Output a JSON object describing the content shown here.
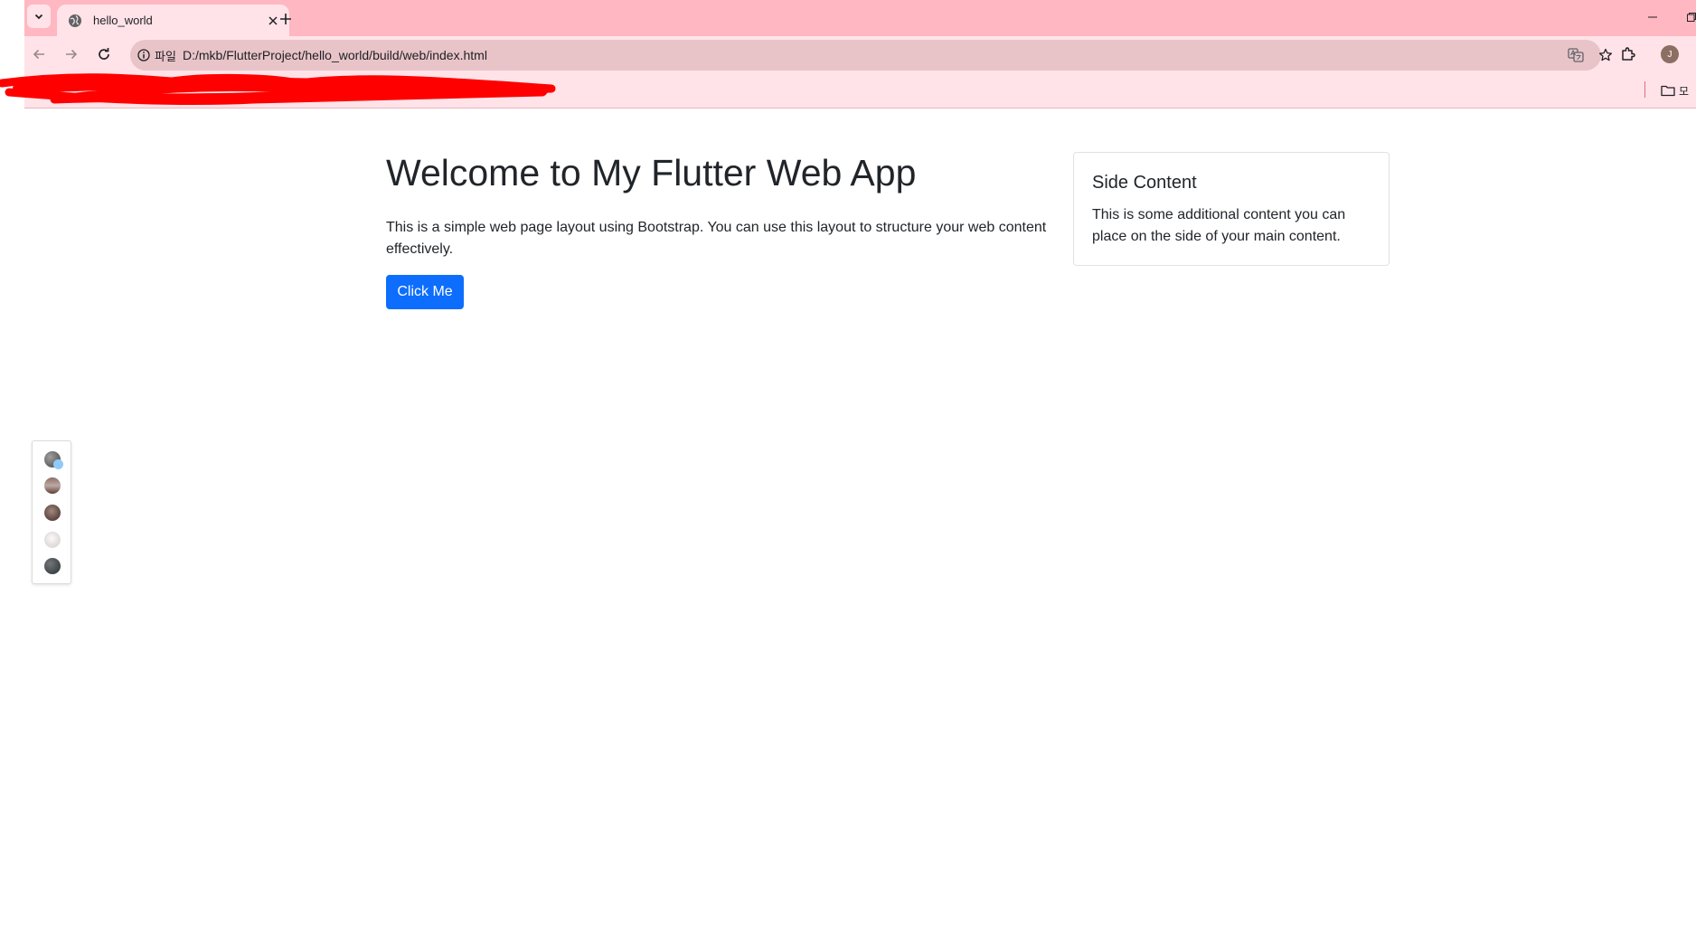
{
  "browser": {
    "tab_title": "hello_world",
    "site_info_label": "파일",
    "url": "D:/mkb/FlutterProject/hello_world/build/web/index.html",
    "avatar_initial": "J",
    "bookmarks_folder_label": "모",
    "icons": {
      "tab_list": "chevron-down-icon",
      "favicon": "globe-icon",
      "tab_close": "close-icon",
      "new_tab": "plus-icon",
      "back": "arrow-left-icon",
      "forward": "arrow-right-icon",
      "reload": "reload-icon",
      "site_info": "info-icon",
      "translate": "translate-icon",
      "bookmark": "star-icon",
      "extensions": "puzzle-icon",
      "bookmarks_folder": "folder-icon"
    },
    "colors": {
      "frame": "#ffb7c2",
      "toolbar": "#ffe3e8",
      "omnibox": "#e8c4c9",
      "redaction": "#ff0000"
    }
  },
  "page": {
    "title": "Welcome to My Flutter Web App",
    "intro": "This is a simple web page layout using Bootstrap. You can use this layout to structure your web content effectively.",
    "button_label": "Click Me",
    "side": {
      "title": "Side Content",
      "text": "This is some additional content you can place on the side of your main content."
    },
    "colors": {
      "primary_button": "#0d6efd",
      "text": "#212529"
    }
  },
  "floating_panel": {
    "avatar_count": 5
  }
}
